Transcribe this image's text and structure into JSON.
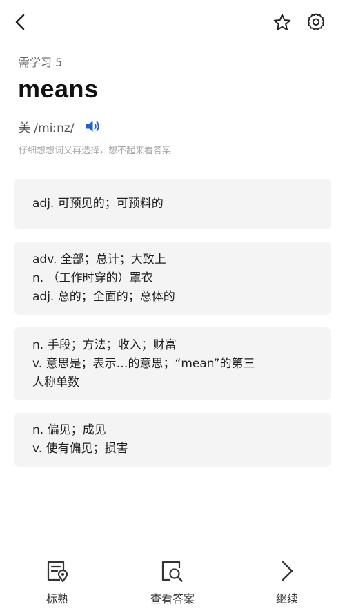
{
  "header": {
    "back_icon": "chevron-left-icon",
    "star_icon": "star-outline-icon",
    "settings_icon": "gear-icon"
  },
  "study": {
    "need_label": "需学习 5",
    "word": "means",
    "phonetic": "美 /miːnz/",
    "speaker_icon": "speaker-icon",
    "hint": "仔细想想词义再选择，想不起来看答案"
  },
  "options": [
    {
      "lines": [
        "adj. 可预见的；可预料的"
      ]
    },
    {
      "lines": [
        "adv. 全部；总计；大致上",
        "n. （工作时穿的）罩衣",
        "adj. 总的；全面的；总体的"
      ]
    },
    {
      "lines": [
        "n. 手段；方法；收入；财富",
        "v. 意思是；表示…的意思；“mean”的第三",
        "人称单数"
      ]
    },
    {
      "lines": [
        "n. 偏见；成见",
        "v. 使有偏见；损害"
      ]
    }
  ],
  "bottom": {
    "mark_label": "标熟",
    "answer_label": "查看答案",
    "continue_label": "继续"
  },
  "colors": {
    "speaker": "#1f5fd1",
    "card_bg": "#f4f4f4",
    "icon": "#333333"
  }
}
